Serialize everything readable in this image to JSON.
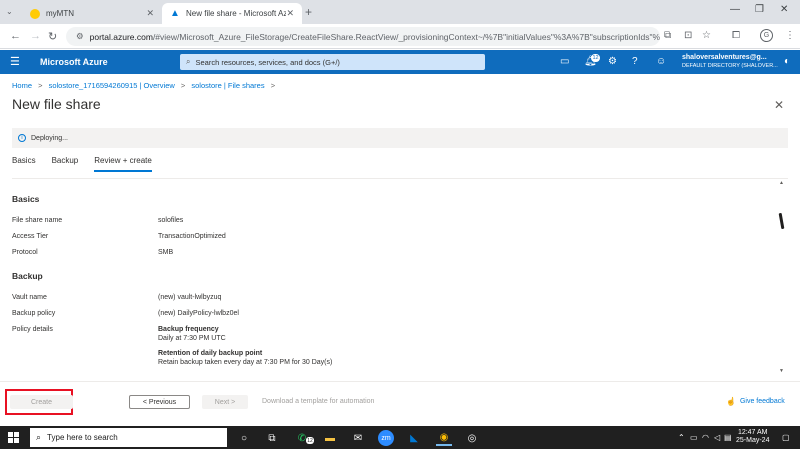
{
  "browser": {
    "tabs": [
      {
        "title": "myMTN"
      },
      {
        "title": "New file share - Microsoft Azu"
      }
    ],
    "url_domain": "portal.azure.com",
    "url_rest": "/#view/Microsoft_Azure_FileStorage/CreateFileShare.ReactView/_provisioningContext~/%7B\"initialValues\"%3A%7B\"subscriptionIds\"%3A%...",
    "profile_initial": "G"
  },
  "azure": {
    "brand": "Microsoft Azure",
    "search_placeholder": "Search resources, services, and docs (G+/)",
    "notification_count": "12",
    "account_email": "shaloversalventures@g...",
    "account_dir": "DEFAULT DIRECTORY (SHALOVER..."
  },
  "breadcrumb": {
    "home": "Home",
    "overview": "solostore_1716594260915 | Overview",
    "fileshares": "solostore | File shares"
  },
  "page": {
    "title": "New file share",
    "banner": "Deploying..."
  },
  "tabs": [
    {
      "label": "Basics"
    },
    {
      "label": "Backup"
    },
    {
      "label": "Review + create"
    }
  ],
  "review": {
    "basics_heading": "Basics",
    "basics": [
      {
        "key": "File share name",
        "value": "solofiles"
      },
      {
        "key": "Access Tier",
        "value": "TransactionOptimized"
      },
      {
        "key": "Protocol",
        "value": "SMB"
      }
    ],
    "backup_heading": "Backup",
    "backup": [
      {
        "key": "Vault name",
        "value": "(new) vault-lwlbyzuq"
      },
      {
        "key": "Backup policy",
        "value": "(new) DailyPolicy-lwlbz0el"
      },
      {
        "key": "Policy details",
        "value": ""
      }
    ],
    "policy": {
      "freq_title": "Backup frequency",
      "freq_value": "Daily at 7:30 PM UTC",
      "ret_title": "Retention of daily backup point",
      "ret_value": "Retain backup taken every day at 7:30 PM for 30 Day(s)"
    }
  },
  "footer": {
    "create": "Create",
    "previous": "< Previous",
    "next": "Next >",
    "template": "Download a template for automation",
    "feedback": "Give feedback"
  },
  "taskbar": {
    "search_placeholder": "Type here to search",
    "whatsapp_badge": "12",
    "time": "12:47 AM",
    "date": "25-May-24"
  }
}
